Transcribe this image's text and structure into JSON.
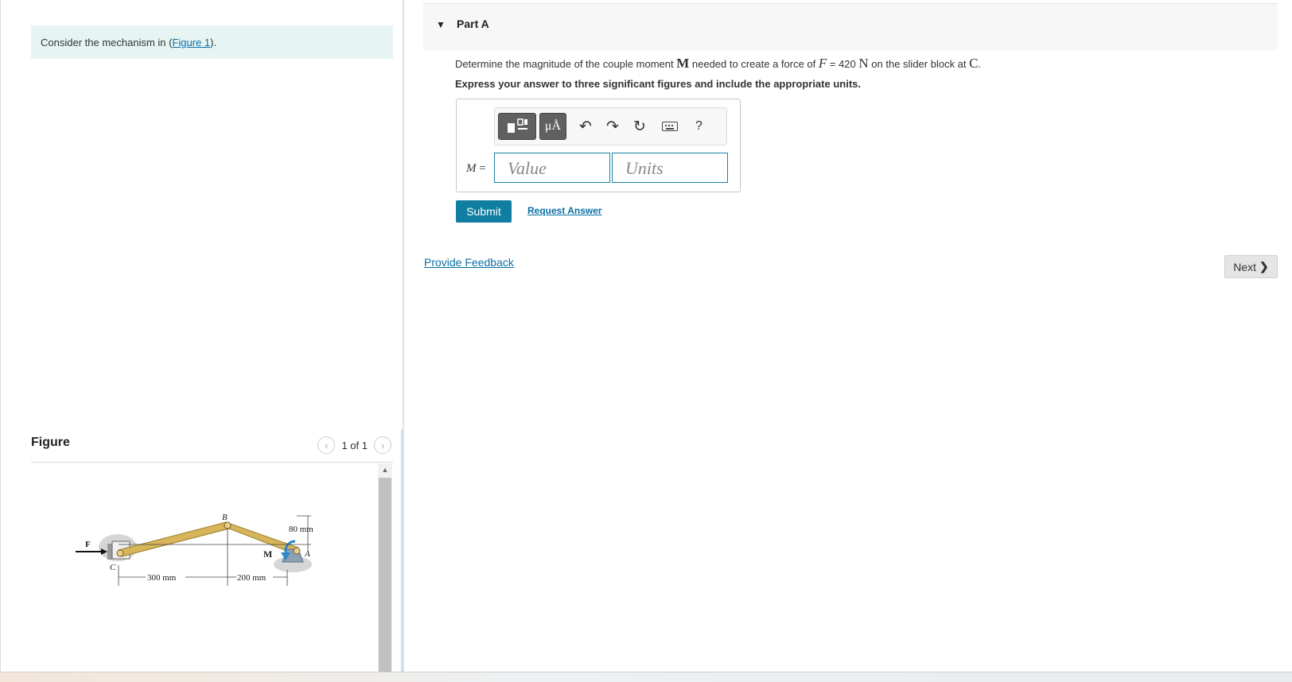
{
  "intro": {
    "text_before": "Consider the mechanism in (",
    "link": "Figure 1",
    "text_after": ")."
  },
  "figure": {
    "title": "Figure",
    "pager_text": "1 of 1",
    "labels": {
      "B": "B",
      "C": "C",
      "A": "A",
      "F": "F",
      "M": "M",
      "dim_300": "300 mm",
      "dim_200": "200 mm",
      "dim_80": "80 mm"
    },
    "colors": {
      "link_bar": "#d7b55a",
      "support": "#8aa0b4",
      "moment_arrow": "#2f87c8"
    }
  },
  "part": {
    "caret": "▼",
    "title": "Part A",
    "question": {
      "t1": "Determine the magnitude of the couple moment ",
      "s1": "M",
      "t2": " needed to create a force of ",
      "s2": "F",
      "t3": " = 420 ",
      "s3": "N",
      "t4": " on the slider block at ",
      "s4": "C",
      "t5": "."
    },
    "instruction": "Express your answer to three significant figures and include the appropriate units.",
    "toolbar": {
      "templates_icon": "templates-icon",
      "units_label": "μÅ",
      "undo_icon": "undo-icon",
      "redo_icon": "redo-icon",
      "reset_icon": "reset-icon",
      "keyboard_icon": "keyboard-icon",
      "help_label": "?"
    },
    "answer": {
      "variable": "M",
      "equals": " =",
      "value_placeholder": "Value",
      "units_placeholder": "Units"
    },
    "submit_label": "Submit",
    "request_answer_label": "Request Answer"
  },
  "feedback_label": "Provide Feedback",
  "next_label": "Next",
  "colors": {
    "accent": "#0f7ea0",
    "link": "#0b6fa4",
    "intro_bg": "#e6f5f4"
  }
}
